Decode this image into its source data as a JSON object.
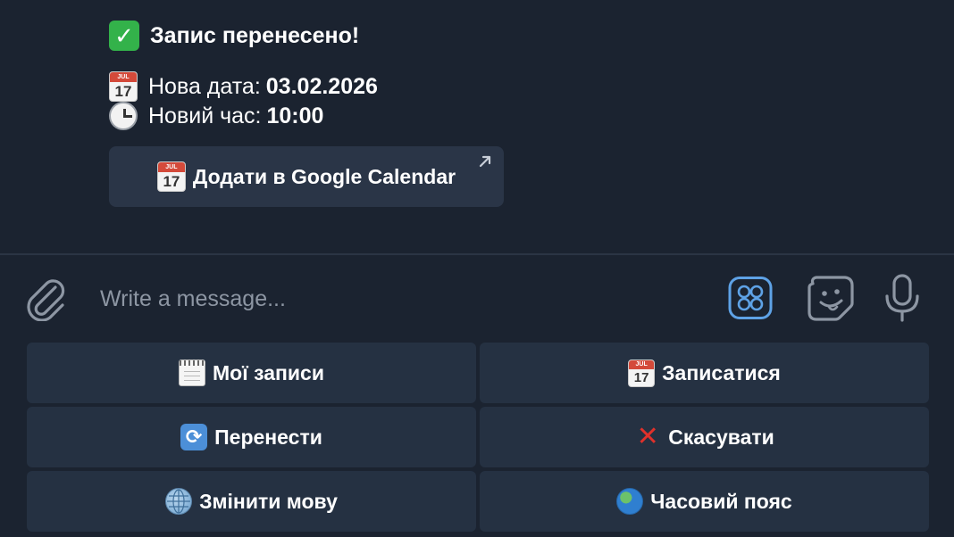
{
  "message": {
    "title": "Запис перенесено!",
    "date_label": "Нова дата:",
    "date_value": "03.02.2026",
    "time_label": "Новий час:",
    "time_value": "10:00",
    "calendar_icon_month": "JUL",
    "calendar_icon_day": "17",
    "inline_button_label": "Додати в Google Calendar"
  },
  "composer": {
    "placeholder": "Write a message..."
  },
  "keyboard": {
    "my_bookings": "Мої записи",
    "book": "Записатися",
    "reschedule": "Перенести",
    "cancel": "Скасувати",
    "change_language": "Змінити мову",
    "timezone": "Часовий пояс"
  },
  "colors": {
    "background": "#1b2330",
    "button_bg": "#253142",
    "accent_blue": "#5ea2e6"
  }
}
